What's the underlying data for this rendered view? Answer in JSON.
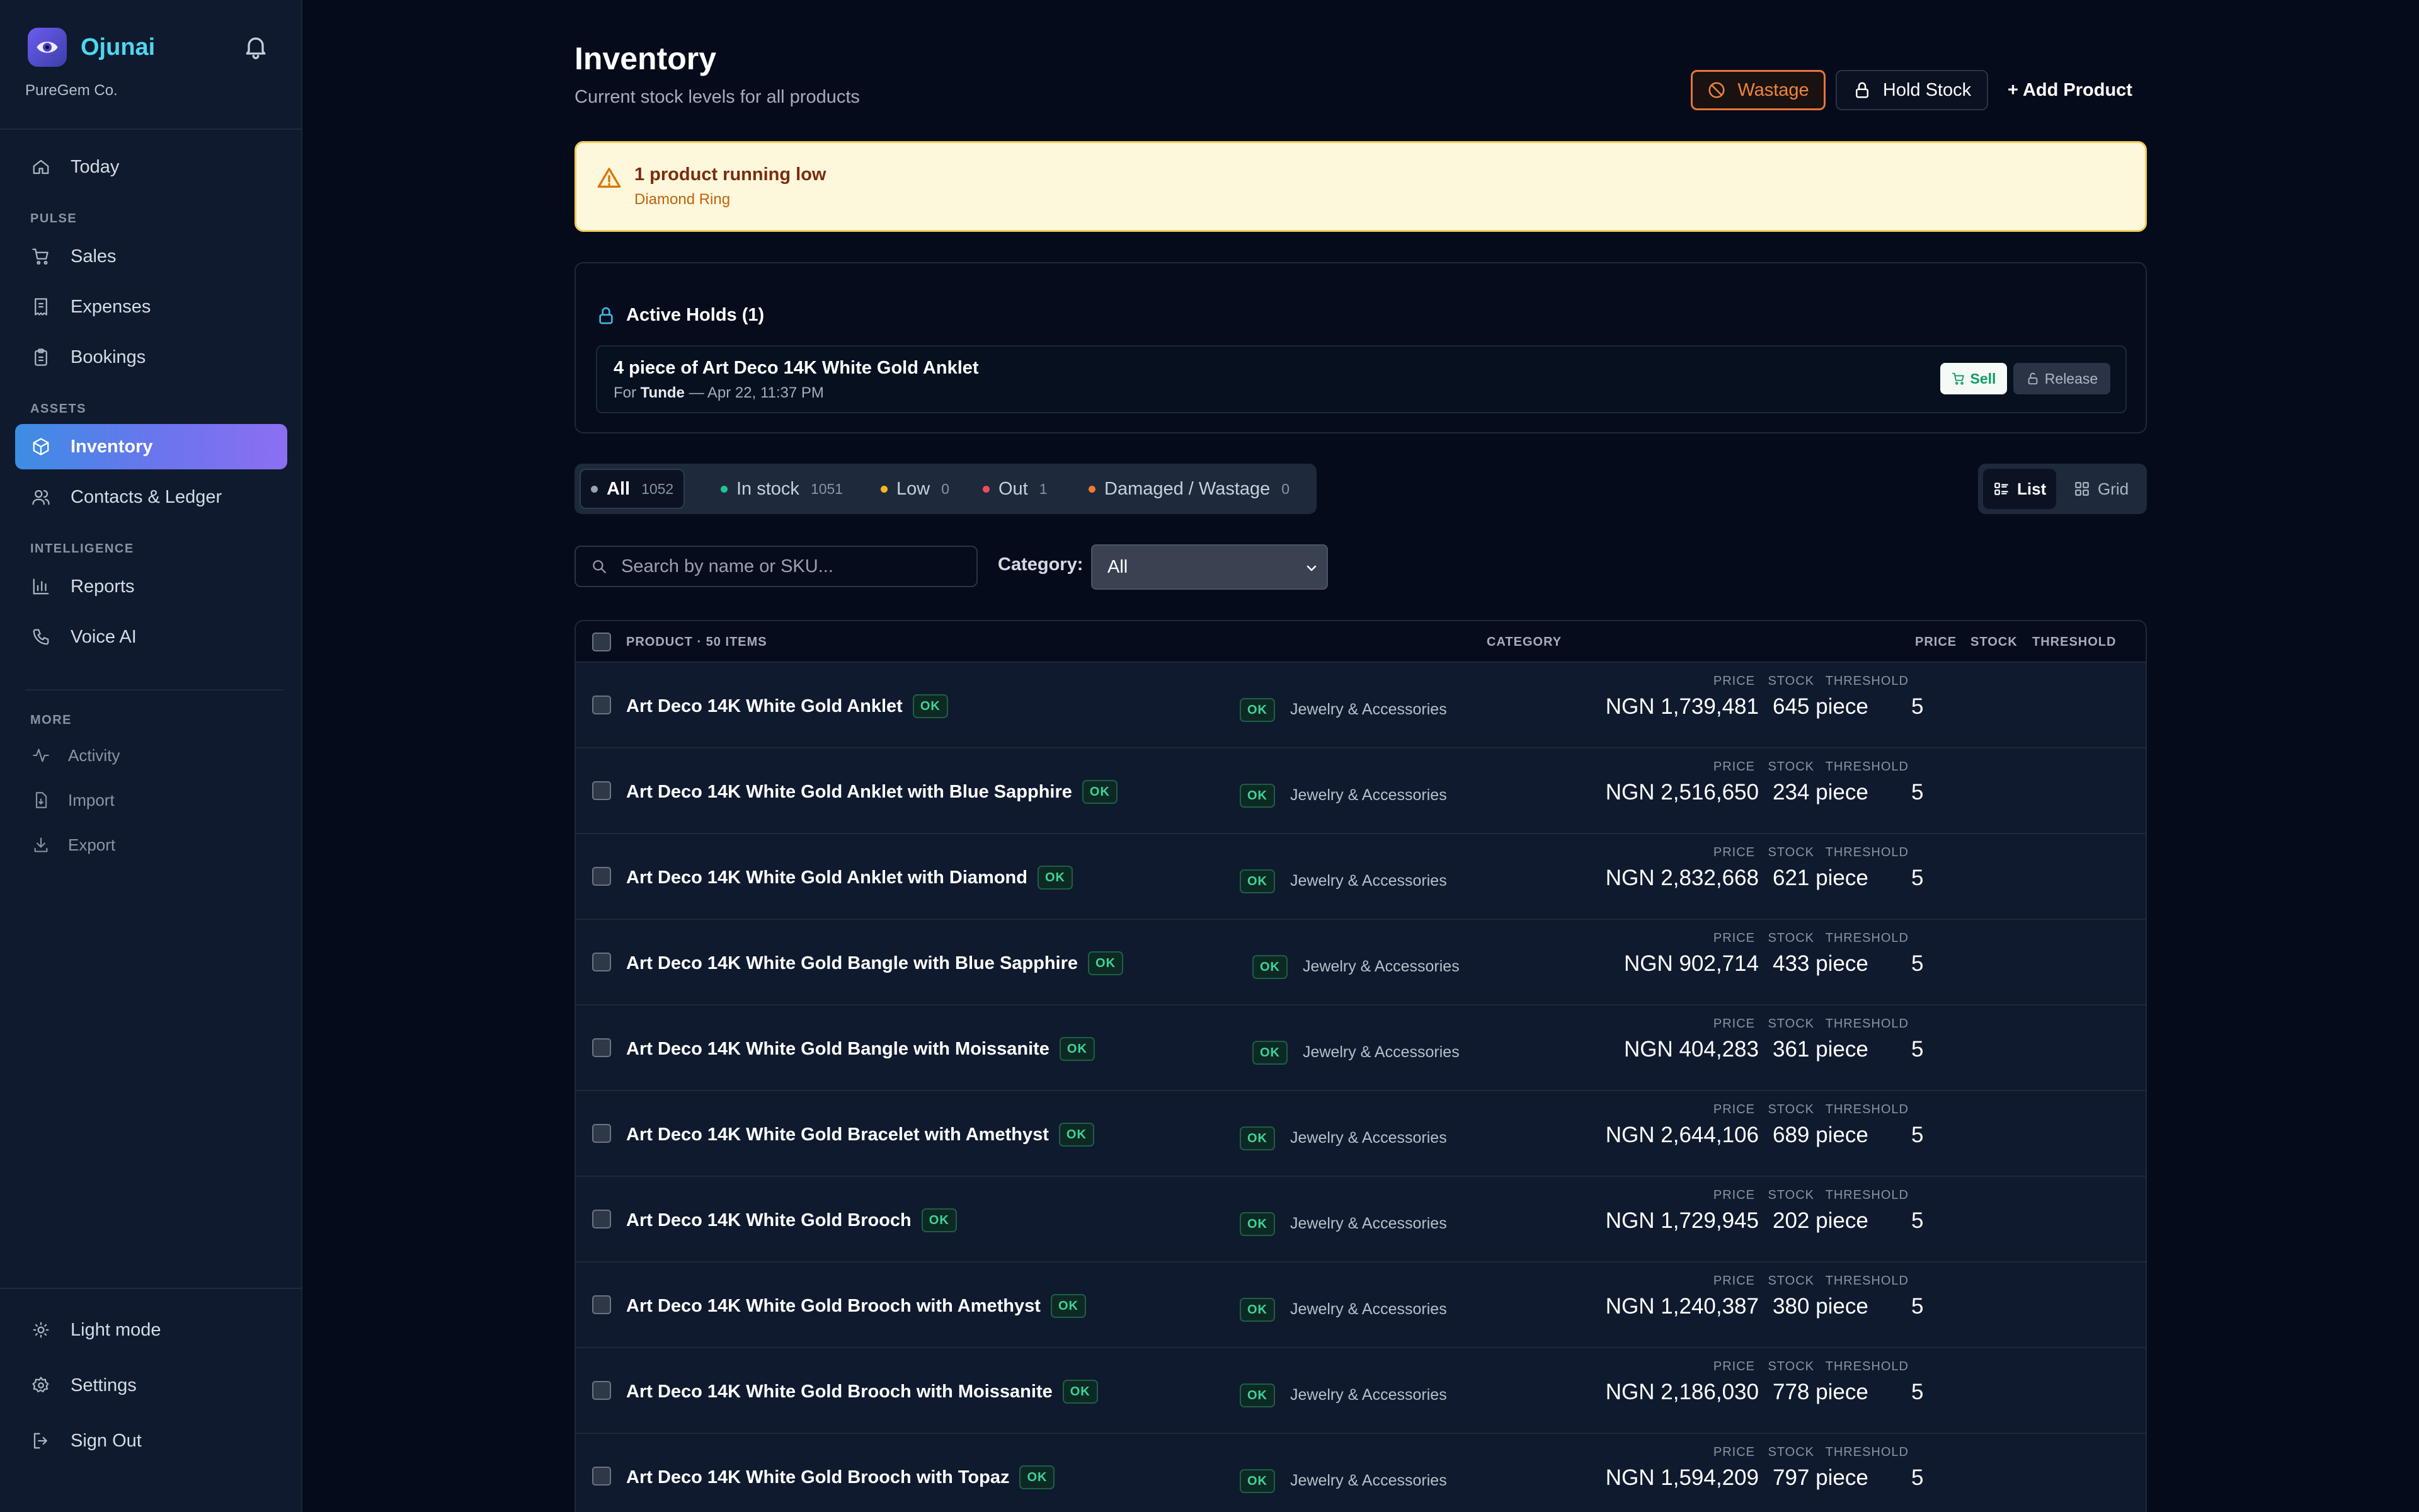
{
  "brand": {
    "name": "Ojunai",
    "company": "PureGem Co."
  },
  "nav": {
    "today": "Today",
    "pulse_label": "PULSE",
    "sales": "Sales",
    "expenses": "Expenses",
    "bookings": "Bookings",
    "assets_label": "ASSETS",
    "inventory": "Inventory",
    "contacts": "Contacts & Ledger",
    "intelligence_label": "INTELLIGENCE",
    "reports": "Reports",
    "voice_ai": "Voice AI",
    "more_label": "MORE",
    "activity": "Activity",
    "import": "Import",
    "export": "Export",
    "light_mode": "Light mode",
    "settings": "Settings",
    "sign_out": "Sign Out"
  },
  "header": {
    "title": "Inventory",
    "subtitle": "Current stock levels for all products",
    "wastage_label": "Wastage",
    "hold_label": "Hold Stock",
    "add_label": "+ Add Product"
  },
  "alert": {
    "title": "1 product running low",
    "item": "Diamond Ring"
  },
  "holds": {
    "title": "Active Holds (1)",
    "item": {
      "name": "4 piece of Art Deco 14K White Gold Anklet",
      "for_prefix": "For",
      "customer": "Tunde",
      "time": "— Apr 22, 11:37 PM",
      "sell_label": "Sell",
      "release_label": "Release"
    }
  },
  "filters": {
    "all": {
      "label": "All",
      "count": "1052"
    },
    "in_stock": {
      "label": "In stock",
      "count": "1051"
    },
    "low": {
      "label": "Low",
      "count": "0"
    },
    "out": {
      "label": "Out",
      "count": "1"
    },
    "damaged": {
      "label": "Damaged / Wastage",
      "count": "0"
    }
  },
  "view": {
    "list": "List",
    "grid": "Grid",
    "selected": "List"
  },
  "search": {
    "placeholder": "Search by name or SKU...",
    "value": ""
  },
  "category": {
    "label": "Category:",
    "selected": "All"
  },
  "table": {
    "headers": {
      "product": "PRODUCT · 50 ITEMS",
      "category": "CATEGORY",
      "price": "PRICE",
      "stock": "STOCK",
      "threshold": "THRESHOLD"
    },
    "mini": {
      "price": "PRICE",
      "stock": "STOCK",
      "threshold": "THRESHOLD"
    },
    "rows": [
      {
        "name": "Art Deco 14K White Gold Anklet",
        "badge": "OK",
        "status": "OK",
        "category": "Jewelry & Accessories",
        "price": "NGN 1,739,481",
        "stock": "645 piece",
        "threshold": "5"
      },
      {
        "name": "Art Deco 14K White Gold Anklet with Blue Sapphire",
        "badge": "OK",
        "status": "OK",
        "category": "Jewelry & Accessories",
        "price": "NGN 2,516,650",
        "stock": "234 piece",
        "threshold": "5"
      },
      {
        "name": "Art Deco 14K White Gold Anklet with Diamond",
        "badge": "OK",
        "status": "OK",
        "category": "Jewelry & Accessories",
        "price": "NGN 2,832,668",
        "stock": "621 piece",
        "threshold": "5"
      },
      {
        "name": "Art Deco 14K White Gold Bangle with Blue Sapphire",
        "badge": "OK",
        "status": "OK",
        "category": "Jewelry & Accessories",
        "price": "NGN 902,714",
        "stock": "433 piece",
        "threshold": "5"
      },
      {
        "name": "Art Deco 14K White Gold Bangle with Moissanite",
        "badge": "OK",
        "status": "OK",
        "category": "Jewelry & Accessories",
        "price": "NGN 404,283",
        "stock": "361 piece",
        "threshold": "5"
      },
      {
        "name": "Art Deco 14K White Gold Bracelet with Amethyst",
        "badge": "OK",
        "status": "OK",
        "category": "Jewelry & Accessories",
        "price": "NGN 2,644,106",
        "stock": "689 piece",
        "threshold": "5"
      },
      {
        "name": "Art Deco 14K White Gold Brooch",
        "badge": "OK",
        "status": "OK",
        "category": "Jewelry & Accessories",
        "price": "NGN 1,729,945",
        "stock": "202 piece",
        "threshold": "5"
      },
      {
        "name": "Art Deco 14K White Gold Brooch with Amethyst",
        "badge": "OK",
        "status": "OK",
        "category": "Jewelry & Accessories",
        "price": "NGN 1,240,387",
        "stock": "380 piece",
        "threshold": "5"
      },
      {
        "name": "Art Deco 14K White Gold Brooch with Moissanite",
        "badge": "OK",
        "status": "OK",
        "category": "Jewelry & Accessories",
        "price": "NGN 2,186,030",
        "stock": "778 piece",
        "threshold": "5"
      },
      {
        "name": "Art Deco 14K White Gold Brooch with Topaz",
        "badge": "OK",
        "status": "OK",
        "category": "Jewelry & Accessories",
        "price": "NGN 1,594,209",
        "stock": "797 piece",
        "threshold": "5"
      }
    ]
  },
  "colors": {
    "accent_cyan": "#4dd7f0",
    "accent_gradient_start": "#3d8de4",
    "accent_gradient_end": "#8c6ff2",
    "wastage_orange": "#f0843d",
    "ok_green": "#3ed39a",
    "low_yellow": "#f5b81c",
    "out_red": "#ef4b5a",
    "alert_bg": "#fdf8dc"
  },
  "icons": {
    "brand": "eye-logo-icon",
    "notification": "bell-icon",
    "today": "home-icon",
    "sales": "cart-icon",
    "expenses": "receipt-icon",
    "bookings": "clipboard-icon",
    "inventory": "box-icon",
    "contacts": "users-icon",
    "reports": "bar-chart-icon",
    "voice_ai": "phone-icon",
    "activity": "activity-icon",
    "import": "file-import-icon",
    "export": "download-icon",
    "light_mode": "sun-icon",
    "settings": "gear-icon",
    "sign_out": "sign-out-icon"
  }
}
